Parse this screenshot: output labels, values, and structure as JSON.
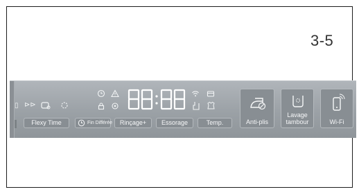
{
  "page": {
    "number": "3-5"
  },
  "panel": {
    "buttons": {
      "flexy_time": "Flexy Time",
      "fin_differee": "Fin Différée",
      "rincage": "Rinçage+",
      "essorage": "Essorage",
      "temp": "Temp.",
      "anti_plis": "Anti-plis",
      "lavage_tambour_line1": "Lavage",
      "lavage_tambour_line2": "tambour",
      "wifi": "Wi-Fi"
    },
    "display": {
      "digits": "88:88",
      "color": "#ffffff"
    },
    "icons": [
      "tub-icon",
      "play-icon",
      "eco-bubble-icon",
      "prewash-icon",
      "clock-icon",
      "warning-icon",
      "lock-icon",
      "child-lock-icon",
      "wifi-signal-icon",
      "door-lock-icon",
      "shirt-icon",
      "steam-icon",
      "iron-icon",
      "drum-icon",
      "phone-icon"
    ]
  },
  "colors": {
    "panel": "#9ba1a6",
    "button": "#888e93",
    "text": "#f6f7f8"
  }
}
